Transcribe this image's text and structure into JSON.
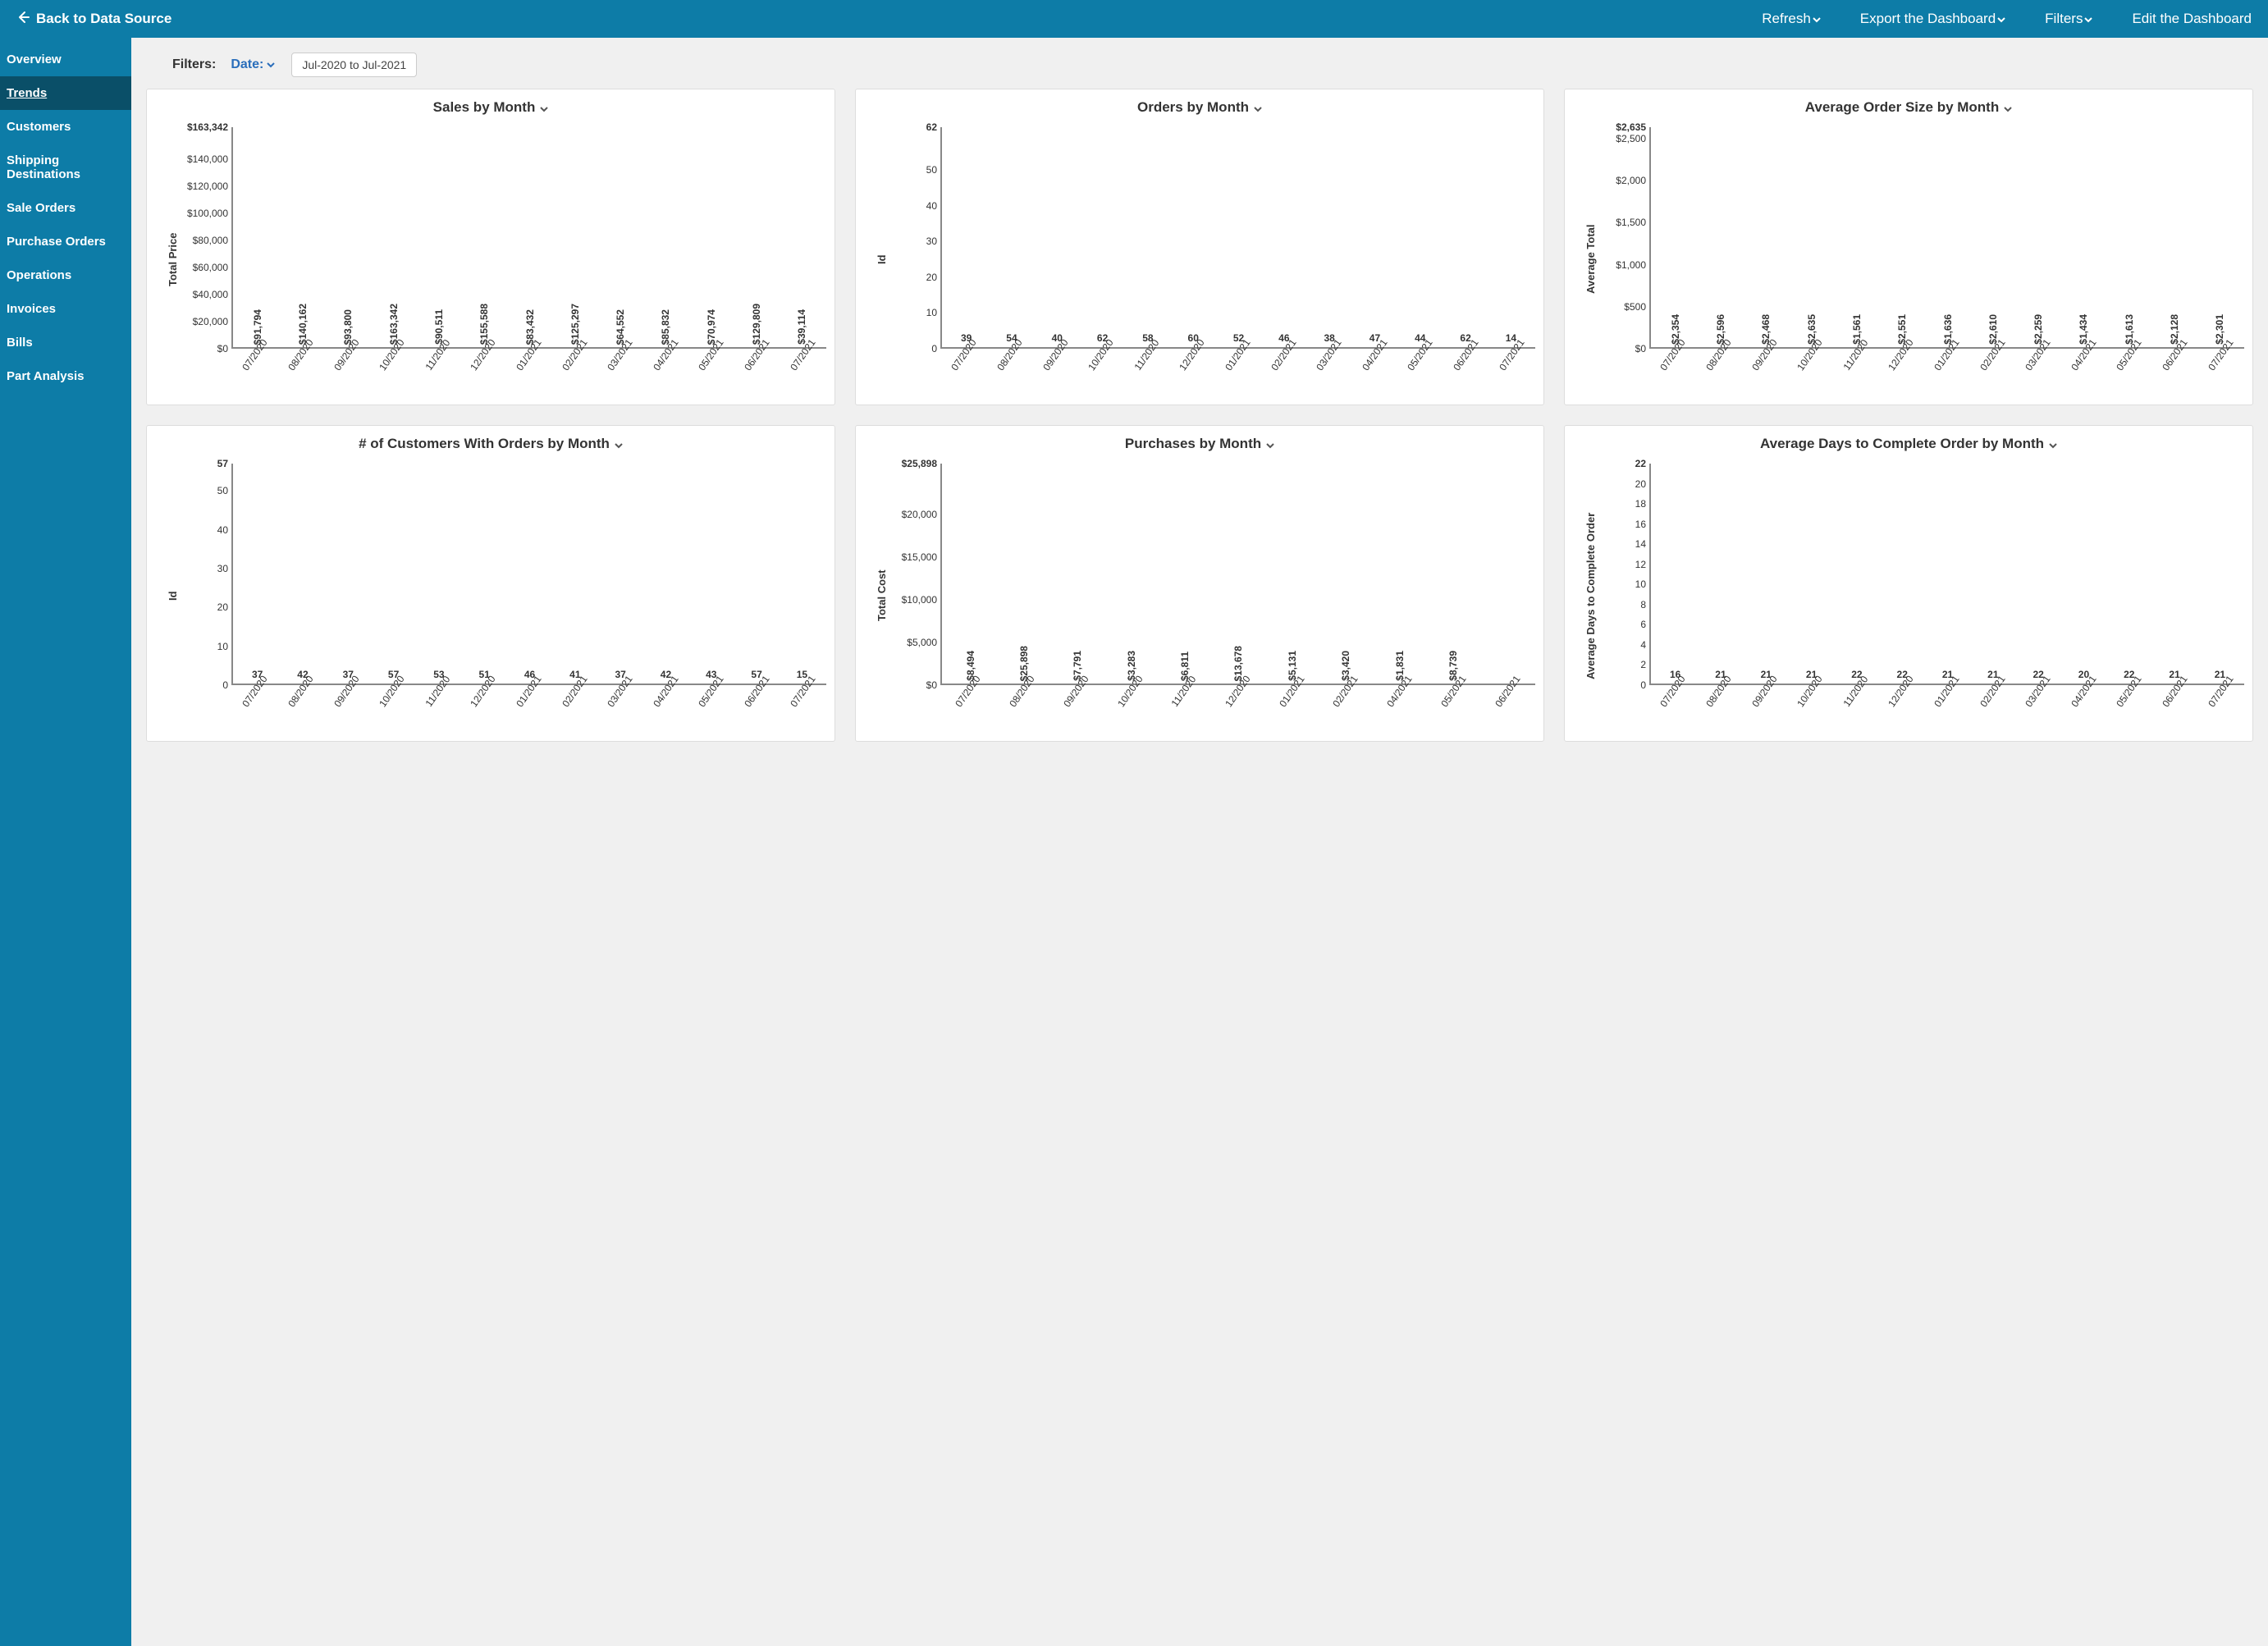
{
  "colors": {
    "brand": "#0d7ca7",
    "brand_dark": "#0a4f68",
    "bar": "#3ea3c9",
    "link": "#2a6ebb"
  },
  "topbar": {
    "back_label": "Back to Data Source",
    "items": [
      {
        "label": "Refresh",
        "caret": true
      },
      {
        "label": "Export the Dashboard",
        "caret": true
      },
      {
        "label": "Filters",
        "caret": true
      },
      {
        "label": "Edit the Dashboard",
        "caret": false
      }
    ]
  },
  "sidebar": {
    "items": [
      {
        "label": "Overview"
      },
      {
        "label": "Trends",
        "active": true
      },
      {
        "label": "Customers"
      },
      {
        "label": "Shipping Destinations"
      },
      {
        "label": "Sale Orders"
      },
      {
        "label": "Purchase Orders"
      },
      {
        "label": "Operations"
      },
      {
        "label": "Invoices"
      },
      {
        "label": "Bills"
      },
      {
        "label": "Part Analysis"
      }
    ]
  },
  "filters": {
    "label": "Filters:",
    "date_label": "Date:",
    "range_label": "Jul-2020 to Jul-2021"
  },
  "months": [
    "07/2020",
    "08/2020",
    "09/2020",
    "10/2020",
    "11/2020",
    "12/2020",
    "01/2021",
    "02/2021",
    "03/2021",
    "04/2021",
    "05/2021",
    "06/2021",
    "07/2021"
  ],
  "months12": [
    "07/2020",
    "08/2020",
    "09/2020",
    "10/2020",
    "11/2020",
    "12/2020",
    "01/2021",
    "02/2021",
    "04/2021",
    "05/2021",
    "06/2021"
  ],
  "chart_data": [
    {
      "id": "sales_by_month",
      "title": "Sales by Month",
      "type": "bar",
      "ylabel": "Total Price",
      "categories_key": "months",
      "values": [
        91794,
        140162,
        93800,
        163342,
        90511,
        155588,
        83432,
        125297,
        64552,
        85832,
        70974,
        129809,
        39114
      ],
      "value_labels": [
        "$91,794",
        "$140,162",
        "$93,800",
        "$163,342",
        "$90,511",
        "$155,588",
        "$83,432",
        "$125,297",
        "$64,552",
        "$85,832",
        "$70,974",
        "$129,809",
        "$39,114"
      ],
      "label_orient": "vertical",
      "ymax": 163342,
      "ymax_label": "$163,342",
      "yticks": [
        {
          "v": 0,
          "l": "$0"
        },
        {
          "v": 20000,
          "l": "$20,000"
        },
        {
          "v": 40000,
          "l": "$40,000"
        },
        {
          "v": 60000,
          "l": "$60,000"
        },
        {
          "v": 80000,
          "l": "$80,000"
        },
        {
          "v": 100000,
          "l": "$100,000"
        },
        {
          "v": 120000,
          "l": "$120,000"
        },
        {
          "v": 140000,
          "l": "$140,000"
        },
        {
          "v": 163342,
          "l": "$163,342",
          "bold": true
        }
      ]
    },
    {
      "id": "orders_by_month",
      "title": "Orders by Month",
      "type": "bar",
      "ylabel": "Id",
      "categories_key": "months",
      "values": [
        39,
        54,
        40,
        62,
        58,
        60,
        52,
        46,
        38,
        47,
        44,
        62,
        14
      ],
      "value_labels": [
        "39",
        "54",
        "40",
        "62",
        "58",
        "60",
        "52",
        "46",
        "38",
        "47",
        "44",
        "62",
        "14"
      ],
      "label_orient": "horizontal",
      "ymax": 62,
      "ymax_label": "62",
      "yticks": [
        {
          "v": 0,
          "l": "0"
        },
        {
          "v": 10,
          "l": "10"
        },
        {
          "v": 20,
          "l": "20"
        },
        {
          "v": 30,
          "l": "30"
        },
        {
          "v": 40,
          "l": "40"
        },
        {
          "v": 50,
          "l": "50"
        },
        {
          "v": 62,
          "l": "62",
          "bold": true
        }
      ]
    },
    {
      "id": "avg_order_size",
      "title": "Average Order Size by Month",
      "type": "bar",
      "ylabel": "Average Total",
      "categories_key": "months",
      "values": [
        2354,
        2596,
        2468,
        2635,
        1561,
        2551,
        1636,
        2610,
        2259,
        1434,
        1613,
        2128,
        2301
      ],
      "value_labels": [
        "$2,354",
        "$2,596",
        "$2,468",
        "$2,635",
        "$1,561",
        "$2,551",
        "$1,636",
        "$2,610",
        "$2,259",
        "$1,434",
        "$1,613",
        "$2,128",
        "$2,301"
      ],
      "label_orient": "vertical",
      "ymax": 2635,
      "ymax_label": "$2,635",
      "yticks": [
        {
          "v": 0,
          "l": "$0"
        },
        {
          "v": 500,
          "l": "$500"
        },
        {
          "v": 1000,
          "l": "$1,000"
        },
        {
          "v": 1500,
          "l": "$1,500"
        },
        {
          "v": 2000,
          "l": "$2,000"
        },
        {
          "v": 2500,
          "l": "$2,500"
        },
        {
          "v": 2635,
          "l": "$2,635",
          "bold": true
        }
      ]
    },
    {
      "id": "customers_by_month",
      "title": "# of Customers With Orders by Month",
      "type": "bar",
      "ylabel": "Id",
      "categories_key": "months",
      "values": [
        37,
        42,
        37,
        57,
        53,
        51,
        46,
        41,
        37,
        42,
        43,
        57,
        15
      ],
      "value_labels": [
        "37",
        "42",
        "37",
        "57",
        "53",
        "51",
        "46",
        "41",
        "37",
        "42",
        "43",
        "57",
        "15"
      ],
      "label_orient": "horizontal",
      "ymax": 57,
      "ymax_label": "57",
      "yticks": [
        {
          "v": 0,
          "l": "0"
        },
        {
          "v": 10,
          "l": "10"
        },
        {
          "v": 20,
          "l": "20"
        },
        {
          "v": 30,
          "l": "30"
        },
        {
          "v": 40,
          "l": "40"
        },
        {
          "v": 50,
          "l": "50"
        },
        {
          "v": 57,
          "l": "57",
          "bold": true
        }
      ]
    },
    {
      "id": "purchases_by_month",
      "title": "Purchases by Month",
      "type": "bar",
      "ylabel": "Total Cost",
      "categories_key": "months12",
      "values": [
        8494,
        25898,
        7791,
        3283,
        6811,
        13678,
        5131,
        3420,
        1831,
        8739,
        0
      ],
      "value_labels": [
        "$8,494",
        "$25,898",
        "$7,791",
        "$3,283",
        "$6,811",
        "$13,678",
        "$5,131",
        "$3,420",
        "$1,831",
        "$8,739",
        ""
      ],
      "label_orient": "vertical",
      "ymax": 25898,
      "ymax_label": "$25,898",
      "yticks": [
        {
          "v": 0,
          "l": "$0"
        },
        {
          "v": 5000,
          "l": "$5,000"
        },
        {
          "v": 10000,
          "l": "$10,000"
        },
        {
          "v": 15000,
          "l": "$15,000"
        },
        {
          "v": 20000,
          "l": "$20,000"
        },
        {
          "v": 25898,
          "l": "$25,898",
          "bold": true
        }
      ]
    },
    {
      "id": "avg_days_complete",
      "title": "Average Days to Complete Order by Month",
      "type": "bar",
      "ylabel": "Average Days to Complete Order",
      "categories_key": "months",
      "values": [
        16,
        21,
        21,
        21,
        22,
        22,
        21,
        21,
        22,
        20,
        22,
        21,
        21
      ],
      "value_labels": [
        "16",
        "21",
        "21",
        "21",
        "22",
        "22",
        "21",
        "21",
        "22",
        "20",
        "22",
        "21",
        "21"
      ],
      "label_orient": "horizontal",
      "ymax": 22,
      "ymax_label": "22",
      "yticks": [
        {
          "v": 0,
          "l": "0"
        },
        {
          "v": 2,
          "l": "2"
        },
        {
          "v": 4,
          "l": "4"
        },
        {
          "v": 6,
          "l": "6"
        },
        {
          "v": 8,
          "l": "8"
        },
        {
          "v": 10,
          "l": "10"
        },
        {
          "v": 12,
          "l": "12"
        },
        {
          "v": 14,
          "l": "14"
        },
        {
          "v": 16,
          "l": "16"
        },
        {
          "v": 18,
          "l": "18"
        },
        {
          "v": 20,
          "l": "20"
        },
        {
          "v": 22,
          "l": "22",
          "bold": true
        }
      ]
    }
  ]
}
